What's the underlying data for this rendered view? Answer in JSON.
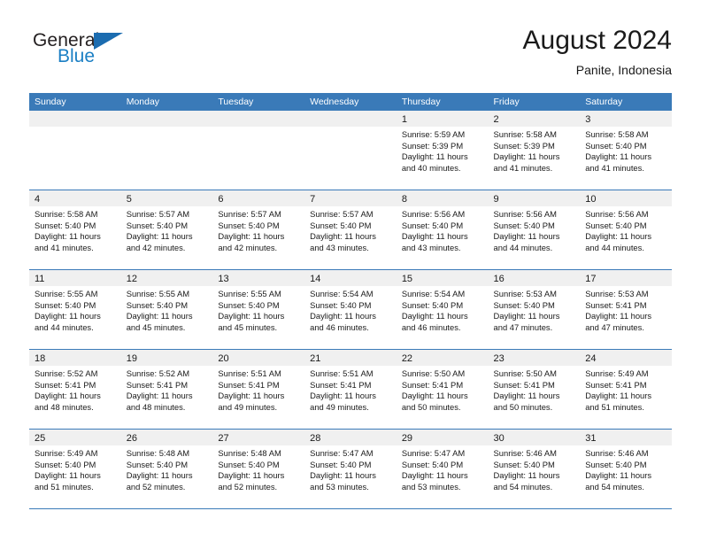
{
  "brand": {
    "name_part1": "General",
    "name_part2": "Blue",
    "triangle_color": "#1b6cb0",
    "blue_color": "#1b7fc4"
  },
  "header": {
    "title": "August 2024",
    "subtitle": "Panite, Indonesia",
    "accent_color": "#3a7ab8"
  },
  "weekdays": [
    "Sunday",
    "Monday",
    "Tuesday",
    "Wednesday",
    "Thursday",
    "Friday",
    "Saturday"
  ],
  "weeks": [
    [
      {
        "day": "",
        "sunrise": "",
        "sunset": "",
        "daylight_line1": "",
        "daylight_line2": ""
      },
      {
        "day": "",
        "sunrise": "",
        "sunset": "",
        "daylight_line1": "",
        "daylight_line2": ""
      },
      {
        "day": "",
        "sunrise": "",
        "sunset": "",
        "daylight_line1": "",
        "daylight_line2": ""
      },
      {
        "day": "",
        "sunrise": "",
        "sunset": "",
        "daylight_line1": "",
        "daylight_line2": ""
      },
      {
        "day": "1",
        "sunrise": "Sunrise: 5:59 AM",
        "sunset": "Sunset: 5:39 PM",
        "daylight_line1": "Daylight: 11 hours",
        "daylight_line2": "and 40 minutes."
      },
      {
        "day": "2",
        "sunrise": "Sunrise: 5:58 AM",
        "sunset": "Sunset: 5:39 PM",
        "daylight_line1": "Daylight: 11 hours",
        "daylight_line2": "and 41 minutes."
      },
      {
        "day": "3",
        "sunrise": "Sunrise: 5:58 AM",
        "sunset": "Sunset: 5:40 PM",
        "daylight_line1": "Daylight: 11 hours",
        "daylight_line2": "and 41 minutes."
      }
    ],
    [
      {
        "day": "4",
        "sunrise": "Sunrise: 5:58 AM",
        "sunset": "Sunset: 5:40 PM",
        "daylight_line1": "Daylight: 11 hours",
        "daylight_line2": "and 41 minutes."
      },
      {
        "day": "5",
        "sunrise": "Sunrise: 5:57 AM",
        "sunset": "Sunset: 5:40 PM",
        "daylight_line1": "Daylight: 11 hours",
        "daylight_line2": "and 42 minutes."
      },
      {
        "day": "6",
        "sunrise": "Sunrise: 5:57 AM",
        "sunset": "Sunset: 5:40 PM",
        "daylight_line1": "Daylight: 11 hours",
        "daylight_line2": "and 42 minutes."
      },
      {
        "day": "7",
        "sunrise": "Sunrise: 5:57 AM",
        "sunset": "Sunset: 5:40 PM",
        "daylight_line1": "Daylight: 11 hours",
        "daylight_line2": "and 43 minutes."
      },
      {
        "day": "8",
        "sunrise": "Sunrise: 5:56 AM",
        "sunset": "Sunset: 5:40 PM",
        "daylight_line1": "Daylight: 11 hours",
        "daylight_line2": "and 43 minutes."
      },
      {
        "day": "9",
        "sunrise": "Sunrise: 5:56 AM",
        "sunset": "Sunset: 5:40 PM",
        "daylight_line1": "Daylight: 11 hours",
        "daylight_line2": "and 44 minutes."
      },
      {
        "day": "10",
        "sunrise": "Sunrise: 5:56 AM",
        "sunset": "Sunset: 5:40 PM",
        "daylight_line1": "Daylight: 11 hours",
        "daylight_line2": "and 44 minutes."
      }
    ],
    [
      {
        "day": "11",
        "sunrise": "Sunrise: 5:55 AM",
        "sunset": "Sunset: 5:40 PM",
        "daylight_line1": "Daylight: 11 hours",
        "daylight_line2": "and 44 minutes."
      },
      {
        "day": "12",
        "sunrise": "Sunrise: 5:55 AM",
        "sunset": "Sunset: 5:40 PM",
        "daylight_line1": "Daylight: 11 hours",
        "daylight_line2": "and 45 minutes."
      },
      {
        "day": "13",
        "sunrise": "Sunrise: 5:55 AM",
        "sunset": "Sunset: 5:40 PM",
        "daylight_line1": "Daylight: 11 hours",
        "daylight_line2": "and 45 minutes."
      },
      {
        "day": "14",
        "sunrise": "Sunrise: 5:54 AM",
        "sunset": "Sunset: 5:40 PM",
        "daylight_line1": "Daylight: 11 hours",
        "daylight_line2": "and 46 minutes."
      },
      {
        "day": "15",
        "sunrise": "Sunrise: 5:54 AM",
        "sunset": "Sunset: 5:40 PM",
        "daylight_line1": "Daylight: 11 hours",
        "daylight_line2": "and 46 minutes."
      },
      {
        "day": "16",
        "sunrise": "Sunrise: 5:53 AM",
        "sunset": "Sunset: 5:40 PM",
        "daylight_line1": "Daylight: 11 hours",
        "daylight_line2": "and 47 minutes."
      },
      {
        "day": "17",
        "sunrise": "Sunrise: 5:53 AM",
        "sunset": "Sunset: 5:41 PM",
        "daylight_line1": "Daylight: 11 hours",
        "daylight_line2": "and 47 minutes."
      }
    ],
    [
      {
        "day": "18",
        "sunrise": "Sunrise: 5:52 AM",
        "sunset": "Sunset: 5:41 PM",
        "daylight_line1": "Daylight: 11 hours",
        "daylight_line2": "and 48 minutes."
      },
      {
        "day": "19",
        "sunrise": "Sunrise: 5:52 AM",
        "sunset": "Sunset: 5:41 PM",
        "daylight_line1": "Daylight: 11 hours",
        "daylight_line2": "and 48 minutes."
      },
      {
        "day": "20",
        "sunrise": "Sunrise: 5:51 AM",
        "sunset": "Sunset: 5:41 PM",
        "daylight_line1": "Daylight: 11 hours",
        "daylight_line2": "and 49 minutes."
      },
      {
        "day": "21",
        "sunrise": "Sunrise: 5:51 AM",
        "sunset": "Sunset: 5:41 PM",
        "daylight_line1": "Daylight: 11 hours",
        "daylight_line2": "and 49 minutes."
      },
      {
        "day": "22",
        "sunrise": "Sunrise: 5:50 AM",
        "sunset": "Sunset: 5:41 PM",
        "daylight_line1": "Daylight: 11 hours",
        "daylight_line2": "and 50 minutes."
      },
      {
        "day": "23",
        "sunrise": "Sunrise: 5:50 AM",
        "sunset": "Sunset: 5:41 PM",
        "daylight_line1": "Daylight: 11 hours",
        "daylight_line2": "and 50 minutes."
      },
      {
        "day": "24",
        "sunrise": "Sunrise: 5:49 AM",
        "sunset": "Sunset: 5:41 PM",
        "daylight_line1": "Daylight: 11 hours",
        "daylight_line2": "and 51 minutes."
      }
    ],
    [
      {
        "day": "25",
        "sunrise": "Sunrise: 5:49 AM",
        "sunset": "Sunset: 5:40 PM",
        "daylight_line1": "Daylight: 11 hours",
        "daylight_line2": "and 51 minutes."
      },
      {
        "day": "26",
        "sunrise": "Sunrise: 5:48 AM",
        "sunset": "Sunset: 5:40 PM",
        "daylight_line1": "Daylight: 11 hours",
        "daylight_line2": "and 52 minutes."
      },
      {
        "day": "27",
        "sunrise": "Sunrise: 5:48 AM",
        "sunset": "Sunset: 5:40 PM",
        "daylight_line1": "Daylight: 11 hours",
        "daylight_line2": "and 52 minutes."
      },
      {
        "day": "28",
        "sunrise": "Sunrise: 5:47 AM",
        "sunset": "Sunset: 5:40 PM",
        "daylight_line1": "Daylight: 11 hours",
        "daylight_line2": "and 53 minutes."
      },
      {
        "day": "29",
        "sunrise": "Sunrise: 5:47 AM",
        "sunset": "Sunset: 5:40 PM",
        "daylight_line1": "Daylight: 11 hours",
        "daylight_line2": "and 53 minutes."
      },
      {
        "day": "30",
        "sunrise": "Sunrise: 5:46 AM",
        "sunset": "Sunset: 5:40 PM",
        "daylight_line1": "Daylight: 11 hours",
        "daylight_line2": "and 54 minutes."
      },
      {
        "day": "31",
        "sunrise": "Sunrise: 5:46 AM",
        "sunset": "Sunset: 5:40 PM",
        "daylight_line1": "Daylight: 11 hours",
        "daylight_line2": "and 54 minutes."
      }
    ]
  ]
}
